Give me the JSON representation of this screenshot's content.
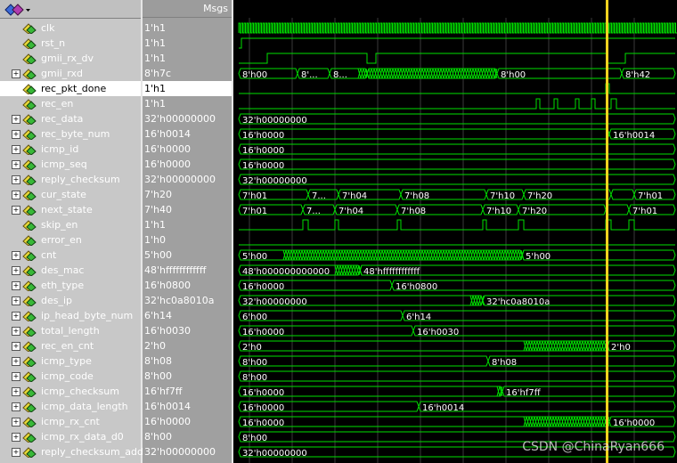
{
  "header": {
    "msgs_label": "Msgs"
  },
  "watermark": "CSDN @ChinaRyan666",
  "rows": [
    {
      "name": "clk",
      "value": "1'h1",
      "expand": false
    },
    {
      "name": "rst_n",
      "value": "1'h1",
      "expand": false
    },
    {
      "name": "gmii_rx_dv",
      "value": "1'h1",
      "expand": false
    },
    {
      "name": "gmii_rxd",
      "value": "8'h7c",
      "expand": true
    },
    {
      "name": "rec_pkt_done",
      "value": "1'h1",
      "expand": false,
      "selected": true
    },
    {
      "name": "rec_en",
      "value": "1'h1",
      "expand": false
    },
    {
      "name": "rec_data",
      "value": "32'h00000000",
      "expand": true
    },
    {
      "name": "rec_byte_num",
      "value": "16'h0014",
      "expand": true
    },
    {
      "name": "icmp_id",
      "value": "16'h0000",
      "expand": true
    },
    {
      "name": "icmp_seq",
      "value": "16'h0000",
      "expand": true
    },
    {
      "name": "reply_checksum",
      "value": "32'h00000000",
      "expand": true
    },
    {
      "name": "cur_state",
      "value": "7'h20",
      "expand": true
    },
    {
      "name": "next_state",
      "value": "7'h40",
      "expand": true
    },
    {
      "name": "skip_en",
      "value": "1'h1",
      "expand": false
    },
    {
      "name": "error_en",
      "value": "1'h0",
      "expand": false
    },
    {
      "name": "cnt",
      "value": "5'h00",
      "expand": true
    },
    {
      "name": "des_mac",
      "value": "48'hffffffffffff",
      "expand": true
    },
    {
      "name": "eth_type",
      "value": "16'h0800",
      "expand": true
    },
    {
      "name": "des_ip",
      "value": "32'hc0a8010a",
      "expand": true
    },
    {
      "name": "ip_head_byte_num",
      "value": "6'h14",
      "expand": true
    },
    {
      "name": "total_length",
      "value": "16'h0030",
      "expand": true
    },
    {
      "name": "rec_en_cnt",
      "value": "2'h0",
      "expand": true
    },
    {
      "name": "icmp_type",
      "value": "8'h08",
      "expand": true
    },
    {
      "name": "icmp_code",
      "value": "8'h00",
      "expand": true
    },
    {
      "name": "icmp_checksum",
      "value": "16'hf7ff",
      "expand": true
    },
    {
      "name": "icmp_data_length",
      "value": "16'h0014",
      "expand": true
    },
    {
      "name": "icmp_rx_cnt",
      "value": "16'h0000",
      "expand": true
    },
    {
      "name": "icmp_rx_data_d0",
      "value": "8'h00",
      "expand": true
    },
    {
      "name": "reply_checksum_add",
      "value": "32'h00000000",
      "expand": true
    }
  ],
  "wave_labels": {
    "gmii_rxd": [
      "8'h00",
      "8'...",
      "8...",
      "8'h00",
      "8'h42"
    ],
    "rec_data": [
      "32'h00000000"
    ],
    "rec_byte_num": [
      "16'h0000",
      "16'h0014"
    ],
    "icmp_id": [
      "16'h0000"
    ],
    "icmp_seq": [
      "16'h0000"
    ],
    "reply_checksum": [
      "32'h00000000"
    ],
    "cur_state": [
      "7'h01",
      "7...",
      "7'h04",
      "7'h08",
      "7'h10",
      "7'h20",
      "7'h01"
    ],
    "next_state": [
      "7'h01",
      "7...",
      "7'h04",
      "7'h08",
      "7'h10",
      "7'h20",
      "7'h01"
    ],
    "cnt": [
      "5'h00",
      "5'h00"
    ],
    "des_mac": [
      "48'h000000000000",
      "48'hffffffffffff"
    ],
    "eth_type": [
      "16'h0000",
      "16'h0800"
    ],
    "des_ip": [
      "32'h00000000",
      "32'hc0a8010a"
    ],
    "ip_head_byte_num": [
      "6'h00",
      "6'h14"
    ],
    "total_length": [
      "16'h0000",
      "16'h0030"
    ],
    "rec_en_cnt": [
      "2'h0",
      "2'h0"
    ],
    "icmp_type": [
      "8'h00",
      "8'h08"
    ],
    "icmp_code": [
      "8'h00"
    ],
    "icmp_checksum": [
      "16'h0000",
      "16'hf7ff"
    ],
    "icmp_data_length": [
      "16'h0000",
      "16'h0014"
    ],
    "icmp_rx_cnt": [
      "16'h0000",
      "16'h0000"
    ],
    "icmp_rx_data_d0": [
      "8'h00"
    ],
    "reply_checksum_add": [
      "32'h00000000"
    ]
  },
  "colors": {
    "wave": "#00e000",
    "cursor": "#ffd21f",
    "grid": "#3a3a3a"
  }
}
